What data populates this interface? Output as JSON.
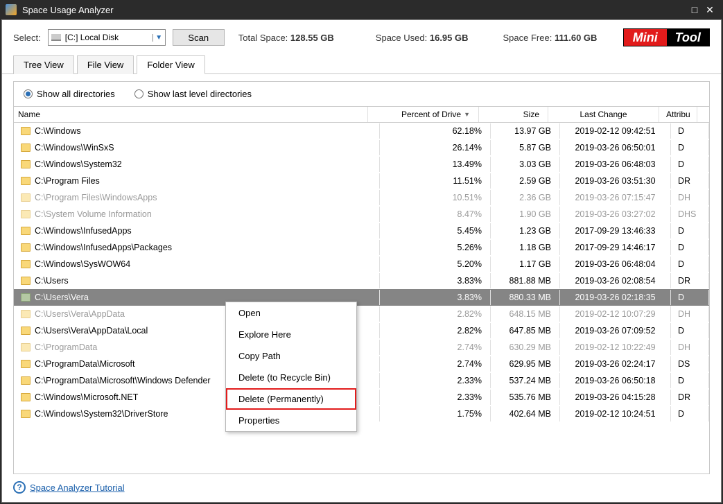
{
  "window": {
    "title": "Space Usage Analyzer"
  },
  "toolbar": {
    "select_label": "Select:",
    "drive_text": "[C:] Local Disk",
    "scan_label": "Scan",
    "total_label": "Total Space:",
    "total_value": "128.55 GB",
    "used_label": "Space Used:",
    "used_value": "16.95 GB",
    "free_label": "Space Free:",
    "free_value": "111.60 GB",
    "logo_left": "Mini",
    "logo_right": "Tool"
  },
  "tabs": {
    "tree": "Tree View",
    "file": "File View",
    "folder": "Folder View"
  },
  "radios": {
    "all": "Show all directories",
    "last": "Show last level directories"
  },
  "columns": {
    "name": "Name",
    "percent": "Percent of Drive",
    "size": "Size",
    "date": "Last Change",
    "attr": "Attribu"
  },
  "rows": [
    {
      "name": "C:\\Windows",
      "pct": "62.18%",
      "size": "13.97 GB",
      "date": "2019-02-12 09:42:51",
      "attr": "D",
      "dim": false,
      "sel": false
    },
    {
      "name": "C:\\Windows\\WinSxS",
      "pct": "26.14%",
      "size": "5.87 GB",
      "date": "2019-03-26 06:50:01",
      "attr": "D",
      "dim": false,
      "sel": false
    },
    {
      "name": "C:\\Windows\\System32",
      "pct": "13.49%",
      "size": "3.03 GB",
      "date": "2019-03-26 06:48:03",
      "attr": "D",
      "dim": false,
      "sel": false
    },
    {
      "name": "C:\\Program Files",
      "pct": "11.51%",
      "size": "2.59 GB",
      "date": "2019-03-26 03:51:30",
      "attr": "DR",
      "dim": false,
      "sel": false
    },
    {
      "name": "C:\\Program Files\\WindowsApps",
      "pct": "10.51%",
      "size": "2.36 GB",
      "date": "2019-03-26 07:15:47",
      "attr": "DH",
      "dim": true,
      "sel": false
    },
    {
      "name": "C:\\System Volume Information",
      "pct": "8.47%",
      "size": "1.90 GB",
      "date": "2019-03-26 03:27:02",
      "attr": "DHS",
      "dim": true,
      "sel": false
    },
    {
      "name": "C:\\Windows\\InfusedApps",
      "pct": "5.45%",
      "size": "1.23 GB",
      "date": "2017-09-29 13:46:33",
      "attr": "D",
      "dim": false,
      "sel": false
    },
    {
      "name": "C:\\Windows\\InfusedApps\\Packages",
      "pct": "5.26%",
      "size": "1.18 GB",
      "date": "2017-09-29 14:46:17",
      "attr": "D",
      "dim": false,
      "sel": false
    },
    {
      "name": "C:\\Windows\\SysWOW64",
      "pct": "5.20%",
      "size": "1.17 GB",
      "date": "2019-03-26 06:48:04",
      "attr": "D",
      "dim": false,
      "sel": false
    },
    {
      "name": "C:\\Users",
      "pct": "3.83%",
      "size": "881.88 MB",
      "date": "2019-03-26 02:08:54",
      "attr": "DR",
      "dim": false,
      "sel": false
    },
    {
      "name": "C:\\Users\\Vera",
      "pct": "3.83%",
      "size": "880.33 MB",
      "date": "2019-03-26 02:18:35",
      "attr": "D",
      "dim": false,
      "sel": true
    },
    {
      "name": "C:\\Users\\Vera\\AppData",
      "pct": "2.82%",
      "size": "648.15 MB",
      "date": "2019-02-12 10:07:29",
      "attr": "DH",
      "dim": true,
      "sel": false
    },
    {
      "name": "C:\\Users\\Vera\\AppData\\Local",
      "pct": "2.82%",
      "size": "647.85 MB",
      "date": "2019-03-26 07:09:52",
      "attr": "D",
      "dim": false,
      "sel": false
    },
    {
      "name": "C:\\ProgramData",
      "pct": "2.74%",
      "size": "630.29 MB",
      "date": "2019-02-12 10:22:49",
      "attr": "DH",
      "dim": true,
      "sel": false
    },
    {
      "name": "C:\\ProgramData\\Microsoft",
      "pct": "2.74%",
      "size": "629.95 MB",
      "date": "2019-03-26 02:24:17",
      "attr": "DS",
      "dim": false,
      "sel": false
    },
    {
      "name": "C:\\ProgramData\\Microsoft\\Windows Defender",
      "pct": "2.33%",
      "size": "537.24 MB",
      "date": "2019-03-26 06:50:18",
      "attr": "D",
      "dim": false,
      "sel": false
    },
    {
      "name": "C:\\Windows\\Microsoft.NET",
      "pct": "2.33%",
      "size": "535.76 MB",
      "date": "2019-03-26 04:15:28",
      "attr": "DR",
      "dim": false,
      "sel": false
    },
    {
      "name": "C:\\Windows\\System32\\DriverStore",
      "pct": "1.75%",
      "size": "402.64 MB",
      "date": "2019-02-12 10:24:51",
      "attr": "D",
      "dim": false,
      "sel": false
    }
  ],
  "context_menu": {
    "open": "Open",
    "explore": "Explore Here",
    "copy": "Copy Path",
    "del_recycle": "Delete (to Recycle Bin)",
    "del_perm": "Delete (Permanently)",
    "props": "Properties"
  },
  "footer": {
    "tutorial": "Space Analyzer Tutorial"
  }
}
